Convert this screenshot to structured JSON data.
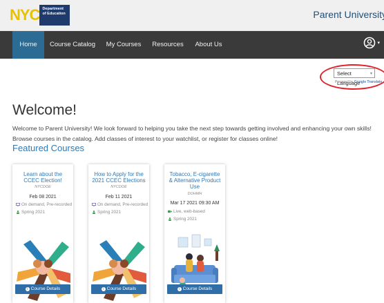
{
  "header": {
    "logo_text": "NYC",
    "logo_dept": "Department of Education",
    "brand": "Parent University"
  },
  "nav": {
    "items": [
      {
        "label": "Home",
        "active": true
      },
      {
        "label": "Course Catalog"
      },
      {
        "label": "My Courses"
      },
      {
        "label": "Resources"
      },
      {
        "label": "About Us"
      }
    ],
    "user_icon": "user-circle-icon",
    "active_color": "#2c6b94"
  },
  "translate": {
    "select_label": "Select Language",
    "powered_prefix": "Powered by",
    "powered_brand": "Google Translate"
  },
  "main": {
    "welcome": "Welcome!",
    "intro": "Welcome to Parent University! We look forward to helping you take the next step towards getting involved and enhancing your own skills! Browse courses in the catalog. Add classes of interest to your watchlist, or register for classes online!",
    "featured_title": "Featured Courses"
  },
  "courses": [
    {
      "title": "Learn about the CCEC Election!",
      "org": "NYCDOE",
      "date": "Feb 08 2021",
      "delivery": "On demand, Pre-recorded",
      "term": "Spring 2021",
      "button": "Course Details",
      "image": "hands-together-illustration"
    },
    {
      "title": "How to Apply for the 2021 CCEC Elections",
      "org": "NYCDOE",
      "date": "Feb 11 2021",
      "delivery": "On demand, Pre-recorded",
      "term": "Spring 2021",
      "button": "Course Details",
      "image": "hands-together-illustration"
    },
    {
      "title": "Tobacco, E-cigarette & Alternative Product Use",
      "org": "DOHMH",
      "date": "Mar 17 2021 09:30 AM",
      "delivery": "Live, web-based",
      "term": "Spring 2021",
      "button": "Course Details",
      "image": "family-on-couch-illustration"
    }
  ],
  "colors": {
    "nav_bg": "#3a3a3a",
    "accent_blue": "#2f79b4",
    "highlight_red": "#e2202b"
  }
}
